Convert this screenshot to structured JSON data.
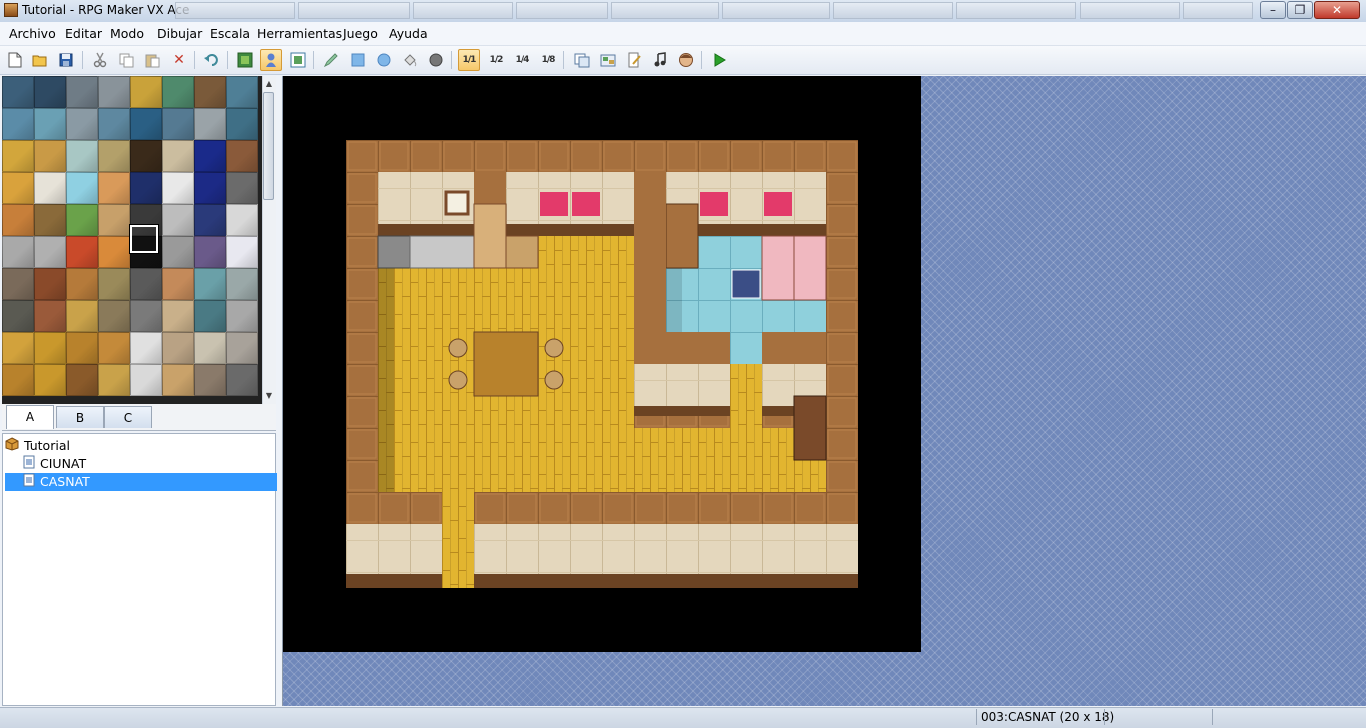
{
  "window": {
    "title": "Tutorial - RPG Maker VX Ace",
    "minimize": "–",
    "maximize": "❐",
    "close": "✕"
  },
  "menu": [
    "Archivo",
    "Editar",
    "Modo",
    "Dibujar",
    "Escala",
    "Herramientas",
    "Juego",
    "Ayuda"
  ],
  "toolbar": {
    "icons": [
      "new-project-icon",
      "open-project-icon",
      "save-project-icon",
      "cut-icon",
      "copy-icon",
      "paste-icon",
      "delete-icon",
      "undo-icon",
      "map-mode-icon",
      "event-mode-icon",
      "region-mode-icon",
      "pencil-icon",
      "rectangle-icon",
      "ellipse-icon",
      "flood-fill-icon",
      "shadow-pen-icon",
      "zoom-1-1-icon",
      "zoom-1-2-icon",
      "zoom-1-4-icon",
      "zoom-1-8-icon",
      "database-icon",
      "resource-manager-icon",
      "script-editor-icon",
      "sound-test-icon",
      "character-generator-icon",
      "playtest-icon"
    ],
    "active": [
      "event-mode-icon",
      "zoom-1-1-icon"
    ],
    "zoom_labels": [
      "1/1",
      "1/2",
      "1/4",
      "1/8"
    ]
  },
  "tileset": {
    "tabs": [
      "A",
      "B",
      "C"
    ],
    "selected_tab": "A",
    "palette": [
      "#3c5f7a",
      "#2e4a63",
      "#6f7c86",
      "#89939a",
      "#c9a23a",
      "#4f8a6c",
      "#7a5a3a",
      "#4f7f96",
      "#5b8ca8",
      "#6aa0b4",
      "#8a9aa4",
      "#5e88a0",
      "#2a5f84",
      "#557a92",
      "#9aa3a8",
      "#3f6f86",
      "#d2a63c",
      "#c99a46",
      "#a8c7c4",
      "#b3a06a",
      "#3a2a1a",
      "#cbbd9f",
      "#1a2a8a",
      "#8a5a3a",
      "#d9a23c",
      "#e6e2d8",
      "#8fd0e2",
      "#d99a5a",
      "#1f2f6a",
      "#e8e8e8",
      "#1c2a86",
      "#6b6b6b",
      "#c77f3a",
      "#8a6a3a",
      "#6aa24a",
      "#c7a06a",
      "#3a3a3a",
      "#bdbdbd",
      "#2a3a7a",
      "#d8d8d8",
      "#a9a9a9",
      "#b0b0b0",
      "#c94a2a",
      "#d98a3a",
      "#111111",
      "#9a9a9a",
      "#6a5a8a",
      "#e8e8f0",
      "#7a6a5a",
      "#8a4a2a",
      "#b57a3a",
      "#9a8a5a",
      "#5a5a5a",
      "#c48a5a",
      "#6aa0a8",
      "#9aa8a8",
      "#5a5a52",
      "#9a5a3a",
      "#c9a24a",
      "#8a7a5a",
      "#7a7a7a",
      "#c9b08a",
      "#4a7a84",
      "#a8a8a8",
      "#d2a23c",
      "#c9982c",
      "#b8822c",
      "#c48a3a",
      "#e0e0e0",
      "#b9a284",
      "#c9c2b0",
      "#a8a29a",
      "#b8822c",
      "#c9982c",
      "#8a5a2a",
      "#c9a24a",
      "#d9d9d9",
      "#c9a26a",
      "#8a7a6a",
      "#6a6a6a"
    ]
  },
  "map_tree": {
    "project": "Tutorial",
    "maps": [
      {
        "name": "CIUNAT",
        "selected": false
      },
      {
        "name": "CASNAT",
        "selected": true
      }
    ]
  },
  "status": {
    "map_info": "003:CASNAT (20 x 18)"
  },
  "colors": {
    "selection": "#3399ff",
    "map_background": "#7088ba",
    "floor": "#e2b530",
    "wall": "#a6703e",
    "wall_face": "#e4d7bd",
    "tile_floor": "#8fd0dc",
    "void": "#000000"
  }
}
